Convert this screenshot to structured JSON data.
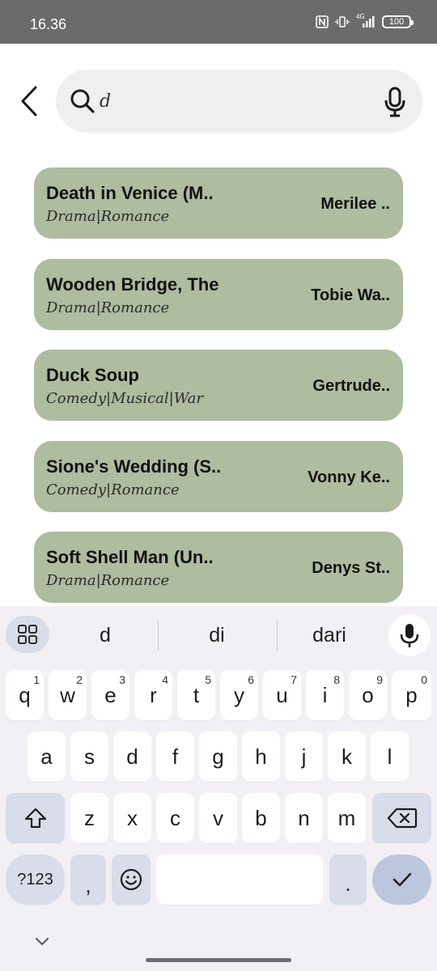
{
  "status_bar": {
    "time": "16.36",
    "icons": [
      "nfc-icon",
      "vibrate-icon",
      "signal-4g-icon",
      "battery-icon"
    ],
    "network": "4G",
    "battery_level": "100"
  },
  "search": {
    "value": "d",
    "placeholder": ""
  },
  "movies": [
    {
      "title": "Death in Venice (M..",
      "genres": "Drama|Romance",
      "director": "Merilee .."
    },
    {
      "title": "Wooden Bridge, The",
      "genres": "Drama|Romance",
      "director": "Tobie Wa.."
    },
    {
      "title": "Duck Soup",
      "genres": "Comedy|Musical|War",
      "director": "Gertrude.."
    },
    {
      "title": "Sione's Wedding (S..",
      "genres": "Comedy|Romance",
      "director": "Vonny Ke.."
    },
    {
      "title": "Soft Shell Man (Un..",
      "genres": "Drama|Romance",
      "director": "Denys St.."
    }
  ],
  "keyboard": {
    "suggestions": [
      "d",
      "di",
      "dari"
    ],
    "row1": [
      "q",
      "w",
      "e",
      "r",
      "t",
      "y",
      "u",
      "i",
      "o",
      "p"
    ],
    "row1_hints": [
      "1",
      "2",
      "3",
      "4",
      "5",
      "6",
      "7",
      "8",
      "9",
      "0"
    ],
    "row2": [
      "a",
      "s",
      "d",
      "f",
      "g",
      "h",
      "j",
      "k",
      "l"
    ],
    "row3": [
      "z",
      "x",
      "c",
      "v",
      "b",
      "n",
      "m"
    ],
    "symbols_label": "?123",
    "comma": ",",
    "period": "."
  },
  "colors": {
    "status_bar": "#6b6b6b",
    "card": "#aebc9f",
    "search_bg": "#efefef",
    "keyboard_bg": "#f2f0f4",
    "key_special": "#d9dde9",
    "enter_key": "#bcc6dc"
  }
}
